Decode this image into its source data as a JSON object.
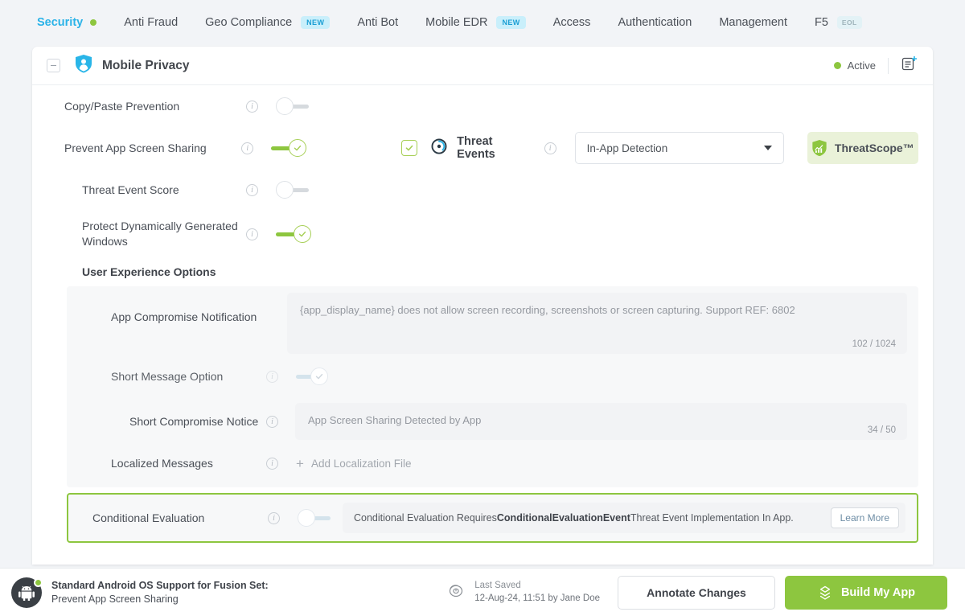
{
  "nav": {
    "items": [
      {
        "label": "Security",
        "active": true,
        "dot": true,
        "badge": null
      },
      {
        "label": "Anti Fraud",
        "active": false,
        "dot": false,
        "badge": null
      },
      {
        "label": "Geo Compliance",
        "active": false,
        "dot": false,
        "badge": "NEW"
      },
      {
        "label": "Anti Bot",
        "active": false,
        "dot": false,
        "badge": null
      },
      {
        "label": "Mobile EDR",
        "active": false,
        "dot": false,
        "badge": "NEW"
      },
      {
        "label": "Access",
        "active": false,
        "dot": false,
        "badge": null
      },
      {
        "label": "Authentication",
        "active": false,
        "dot": false,
        "badge": null
      },
      {
        "label": "Management",
        "active": false,
        "dot": false,
        "badge": null
      },
      {
        "label": "F5",
        "active": false,
        "dot": false,
        "badge": "EOL"
      }
    ]
  },
  "card": {
    "title": "Mobile Privacy",
    "status": "Active"
  },
  "rows": {
    "copy_paste": {
      "label": "Copy/Paste Prevention",
      "toggle": "off"
    },
    "prevent_screen_sharing": {
      "label": "Prevent App Screen Sharing",
      "toggle": "on"
    },
    "threat_event_score": {
      "label": "Threat Event Score",
      "toggle": "off"
    },
    "protect_windows": {
      "label": "Protect Dynamically Generated Windows",
      "toggle": "on"
    },
    "short_message_option": {
      "label": "Short Message Option",
      "toggle": "dim"
    },
    "conditional_evaluation": {
      "label": "Conditional Evaluation",
      "toggle": "off"
    }
  },
  "threat_events": {
    "label": "Threat Events",
    "checkbox_checked": true,
    "dropdown_value": "In-App Detection",
    "threatscope_label": "ThreatScope™"
  },
  "ux": {
    "section_title": "User Experience Options",
    "app_compromise": {
      "label": "App Compromise Notification",
      "value": "{app_display_name} does not allow screen recording, screenshots or screen capturing. Support REF: 6802",
      "counter": "102 / 1024"
    },
    "short_notice": {
      "label": "Short Compromise Notice",
      "value": "App Screen Sharing Detected by App",
      "counter": "34 / 50"
    },
    "localized": {
      "label": "Localized Messages",
      "add_label": "Add Localization File"
    }
  },
  "conditional": {
    "message_pre": "Conditional Evaluation Requires ",
    "message_bold": "ConditionalEvaluationEvent",
    "message_post": " Threat Event Implementation In App.",
    "learn_more": "Learn More"
  },
  "footer": {
    "title": "Standard Android OS Support for Fusion Set:",
    "subtitle": "Prevent App Screen Sharing",
    "last_saved_label": "Last Saved",
    "last_saved_value": "12-Aug-24, 11:51 by Jane Doe",
    "annotate_label": "Annotate Changes",
    "build_label": "Build My App"
  },
  "colors": {
    "accent_green": "#8dc63f",
    "accent_blue": "#2bb3e8",
    "badge_new_bg": "#c9effb"
  }
}
